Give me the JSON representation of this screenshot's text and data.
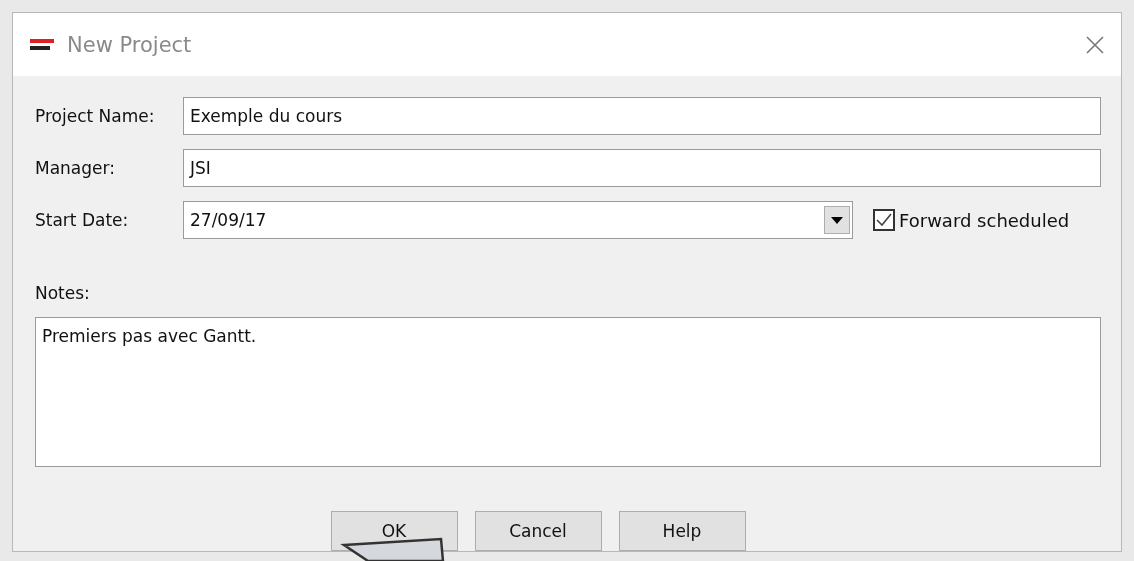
{
  "window": {
    "title": "New Project"
  },
  "fields": [
    {
      "kind": "text",
      "label": "Project Name:",
      "value": "Exemple du cours"
    },
    {
      "kind": "text",
      "label": "Manager:",
      "value": "JSI"
    },
    {
      "kind": "date",
      "label": "Start Date:",
      "value": "27/09/17",
      "checkbox": {
        "label": "Forward scheduled",
        "checked": true
      }
    }
  ],
  "notes": {
    "label": "Notes:",
    "value": "Premiers pas avec Gantt."
  },
  "buttons": [
    "OK",
    "Cancel",
    "Help"
  ]
}
